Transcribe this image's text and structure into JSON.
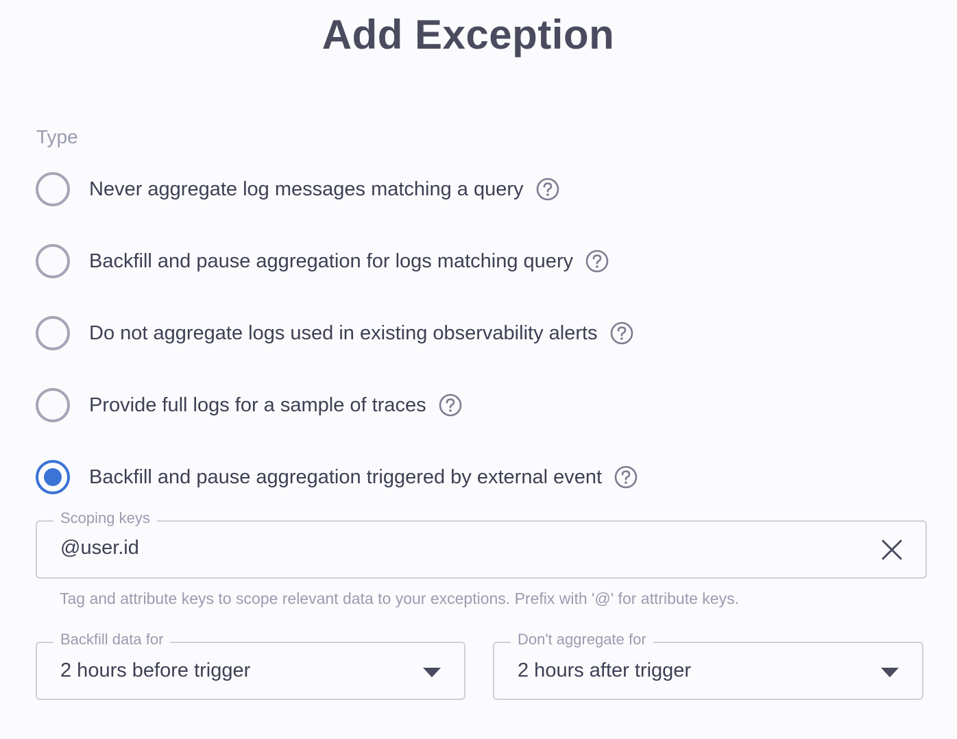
{
  "dialog": {
    "title": "Add Exception"
  },
  "type_section": {
    "label": "Type",
    "options": [
      {
        "label": "Never aggregate log messages matching a query",
        "selected": false,
        "help_icon": "help-circle-icon"
      },
      {
        "label": "Backfill and pause aggregation for logs matching query",
        "selected": false,
        "help_icon": "help-circle-icon"
      },
      {
        "label": "Do not aggregate logs used in existing observability alerts",
        "selected": false,
        "help_icon": "help-circle-icon"
      },
      {
        "label": "Provide full logs for a sample of traces",
        "selected": false,
        "help_icon": "help-circle-icon"
      },
      {
        "label": "Backfill and pause aggregation triggered by external event",
        "selected": true,
        "help_icon": "help-circle-icon"
      }
    ]
  },
  "scoping_keys": {
    "label": "Scoping keys",
    "value": "@user.id",
    "clear_icon": "close-icon",
    "helper": "Tag and attribute keys to scope relevant data to your exceptions. Prefix with '@' for attribute keys."
  },
  "backfill": {
    "label": "Backfill data for",
    "value": "2 hours before trigger",
    "icon": "caret-down-icon"
  },
  "dont_aggregate": {
    "label": "Don't aggregate for",
    "value": "2 hours after trigger",
    "icon": "caret-down-icon"
  },
  "colors": {
    "accent": "#3b73d6",
    "text": "#3d3f54",
    "muted": "#9a9bb0",
    "border": "#cfcfd9"
  }
}
